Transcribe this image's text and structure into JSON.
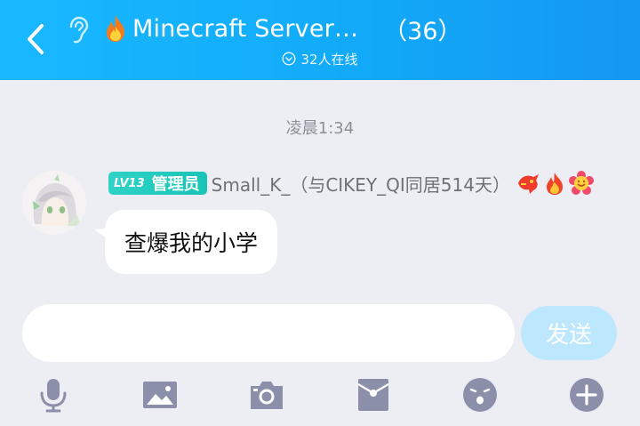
{
  "header": {
    "title": "Minecraft Server…",
    "member_count": "（36）",
    "online_text": "32人在线"
  },
  "chat": {
    "timestamp": "凌晨1:34",
    "messages": [
      {
        "level": "LV13",
        "role": "管理员",
        "sender": "Small_K_（与CIKEY_QI同居514天）",
        "text": "查爆我的小学"
      }
    ]
  },
  "input": {
    "placeholder": "",
    "send_label": "发送"
  },
  "toolbar": {
    "icons": [
      "microphone-icon",
      "image-icon",
      "camera-icon",
      "red-packet-icon",
      "emoji-icon",
      "plus-icon"
    ]
  },
  "colors": {
    "header_start": "#19b9ff",
    "header_end": "#1597f4",
    "background": "#eceef3",
    "send_button": "#bde7fd",
    "level_badge": "#2fd3c6",
    "toolbar_icon": "#8c8faa"
  }
}
